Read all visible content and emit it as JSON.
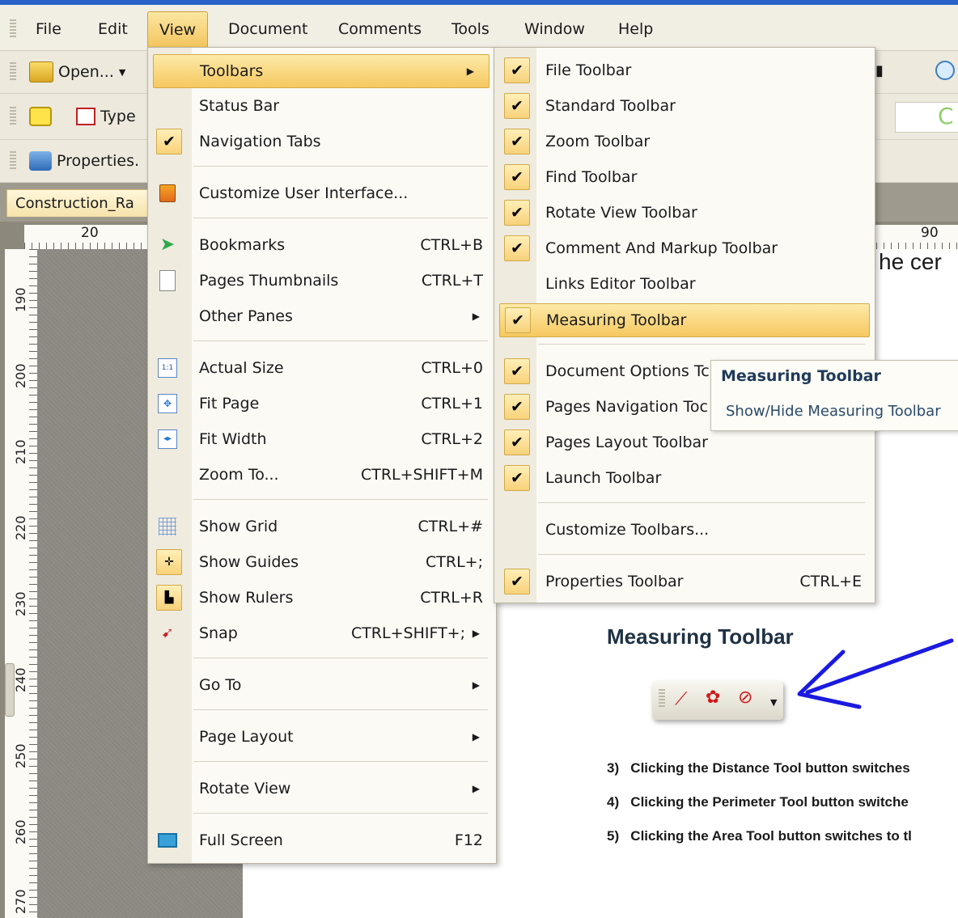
{
  "menubar": {
    "items": [
      "File",
      "Edit",
      "View",
      "Document",
      "Comments",
      "Tools",
      "Window",
      "Help"
    ],
    "active": "View"
  },
  "toolbars": {
    "open_label": "Open...",
    "type_label": "Type",
    "properties_label": "Properties."
  },
  "tab": {
    "label": "Construction_Ra"
  },
  "rulers": {
    "h_labels": [
      "20",
      "90"
    ],
    "v_labels": [
      "190",
      "200",
      "210",
      "220",
      "230",
      "240",
      "250",
      "260",
      "270"
    ]
  },
  "view_menu": {
    "items": [
      {
        "label": "Toolbars",
        "shortcut": "",
        "submenu": true,
        "highlight": true
      },
      {
        "label": "Status Bar",
        "shortcut": ""
      },
      {
        "label": "Navigation Tabs",
        "shortcut": "",
        "checked": true
      },
      {
        "label": "Customize User Interface...",
        "shortcut": ""
      },
      {
        "label": "Bookmarks",
        "shortcut": "CTRL+B"
      },
      {
        "label": "Pages Thumbnails",
        "shortcut": "CTRL+T"
      },
      {
        "label": "Other Panes",
        "shortcut": "",
        "submenu": true
      },
      {
        "label": "Actual Size",
        "shortcut": "CTRL+0"
      },
      {
        "label": "Fit Page",
        "shortcut": "CTRL+1"
      },
      {
        "label": "Fit Width",
        "shortcut": "CTRL+2"
      },
      {
        "label": "Zoom To...",
        "shortcut": "CTRL+SHIFT+M"
      },
      {
        "label": "Show Grid",
        "shortcut": "CTRL+#"
      },
      {
        "label": "Show Guides",
        "shortcut": "CTRL+;"
      },
      {
        "label": "Show Rulers",
        "shortcut": "CTRL+R"
      },
      {
        "label": "Snap",
        "shortcut": "CTRL+SHIFT+;",
        "submenu": true
      },
      {
        "label": "Go To",
        "shortcut": "",
        "submenu": true
      },
      {
        "label": "Page Layout",
        "shortcut": "",
        "submenu": true
      },
      {
        "label": "Rotate View",
        "shortcut": "",
        "submenu": true
      },
      {
        "label": "Full Screen",
        "shortcut": "F12"
      }
    ]
  },
  "toolbars_menu": {
    "items": [
      {
        "label": "File Toolbar",
        "checked": true
      },
      {
        "label": "Standard Toolbar",
        "checked": true
      },
      {
        "label": "Zoom Toolbar",
        "checked": true
      },
      {
        "label": "Find Toolbar",
        "checked": true
      },
      {
        "label": "Rotate View Toolbar",
        "checked": true
      },
      {
        "label": "Comment And Markup Toolbar",
        "checked": true
      },
      {
        "label": "Links Editor Toolbar",
        "checked": false
      },
      {
        "label": "Measuring Toolbar",
        "checked": true,
        "highlight": true
      },
      {
        "label": "Document Options Tc",
        "checked": true
      },
      {
        "label": "Pages Navigation Toc",
        "checked": true
      },
      {
        "label": "Pages Layout Toolbar",
        "checked": true
      },
      {
        "label": "Launch Toolbar",
        "checked": true
      },
      {
        "label": "Customize Toolbars...",
        "checked": false
      },
      {
        "label": "Properties Toolbar",
        "checked": true,
        "shortcut": "CTRL+E"
      }
    ]
  },
  "tooltip": {
    "title": "Measuring Toolbar",
    "body": "Show/Hide Measuring Toolbar"
  },
  "document": {
    "partial_heading": "he cer",
    "section_heading": "Measuring Toolbar",
    "steps": [
      {
        "num": "3)",
        "text": "Clicking the Distance Tool button switches"
      },
      {
        "num": "4)",
        "text": "Clicking the Perimeter Tool button switche"
      },
      {
        "num": "5)",
        "text": "Clicking the Area Tool button switches to tl"
      }
    ]
  },
  "colors": {
    "arrow": "#1a1ae0",
    "highlight": "#f6c860",
    "menubar": "#f1eee4"
  }
}
